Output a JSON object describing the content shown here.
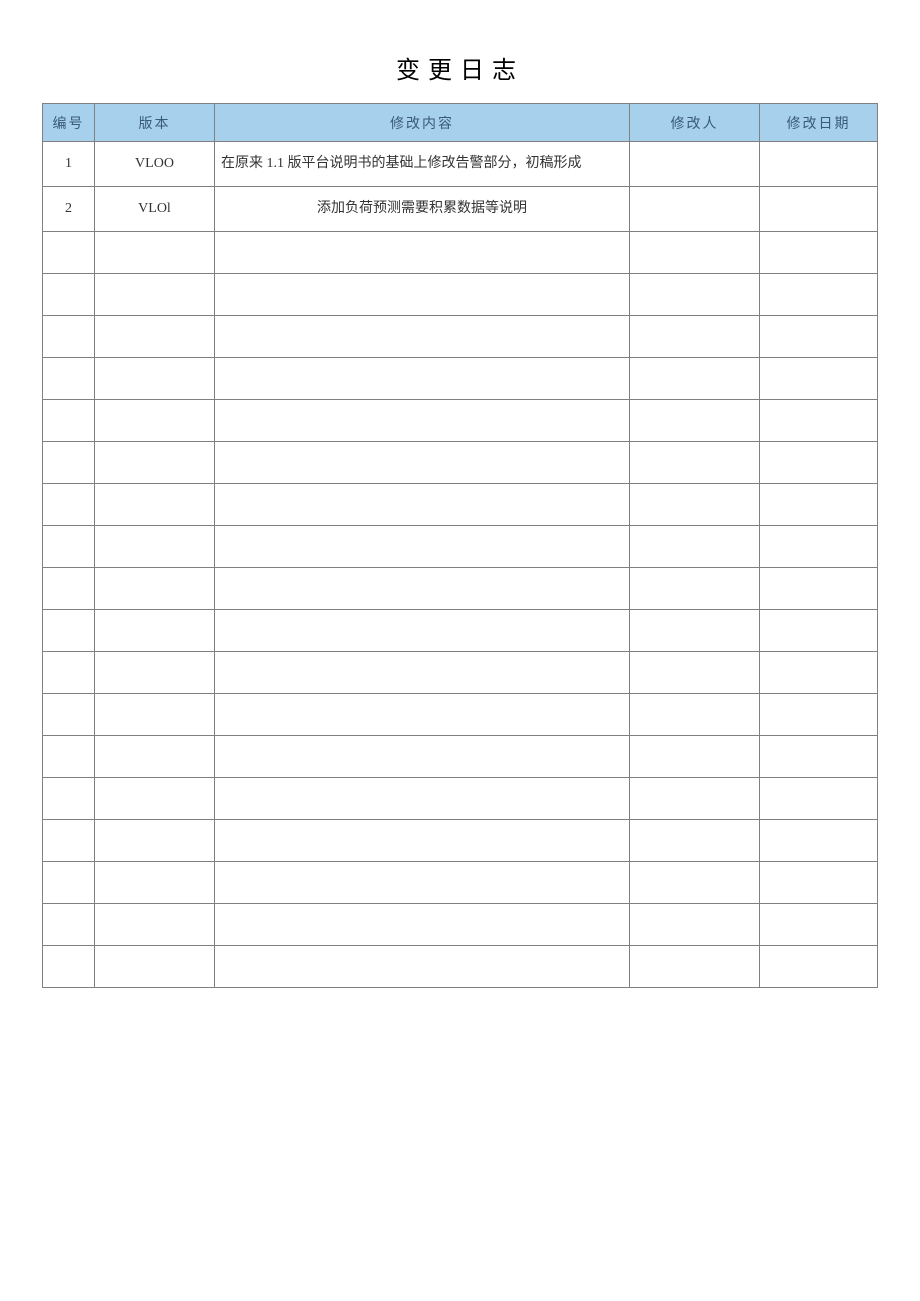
{
  "title": "变更日志",
  "columns": {
    "id": "编号",
    "version": "版本",
    "content": "修改内容",
    "author": "修改人",
    "date": "修改日期"
  },
  "rows": [
    {
      "id": "1",
      "version": "VLOO",
      "content": "在原来 1.1 版平台说明书的基础上修改告警部分，初稿形成",
      "author": "",
      "date": "",
      "content_align": "left",
      "tall": true
    },
    {
      "id": "2",
      "version": "VLOl",
      "content": "添加负荷预测需要积累数据等说明",
      "author": "",
      "date": "",
      "content_align": "center",
      "tall": false
    },
    {
      "id": "",
      "version": "",
      "content": "",
      "author": "",
      "date": "",
      "content_align": "left",
      "tall": false
    },
    {
      "id": "",
      "version": "",
      "content": "",
      "author": "",
      "date": "",
      "content_align": "left",
      "tall": false
    },
    {
      "id": "",
      "version": "",
      "content": "",
      "author": "",
      "date": "",
      "content_align": "left",
      "tall": false
    },
    {
      "id": "",
      "version": "",
      "content": "",
      "author": "",
      "date": "",
      "content_align": "left",
      "tall": false
    },
    {
      "id": "",
      "version": "",
      "content": "",
      "author": "",
      "date": "",
      "content_align": "left",
      "tall": false
    },
    {
      "id": "",
      "version": "",
      "content": "",
      "author": "",
      "date": "",
      "content_align": "left",
      "tall": false
    },
    {
      "id": "",
      "version": "",
      "content": "",
      "author": "",
      "date": "",
      "content_align": "left",
      "tall": false
    },
    {
      "id": "",
      "version": "",
      "content": "",
      "author": "",
      "date": "",
      "content_align": "left",
      "tall": false
    },
    {
      "id": "",
      "version": "",
      "content": "",
      "author": "",
      "date": "",
      "content_align": "left",
      "tall": false
    },
    {
      "id": "",
      "version": "",
      "content": "",
      "author": "",
      "date": "",
      "content_align": "left",
      "tall": false
    },
    {
      "id": "",
      "version": "",
      "content": "",
      "author": "",
      "date": "",
      "content_align": "left",
      "tall": false
    },
    {
      "id": "",
      "version": "",
      "content": "",
      "author": "",
      "date": "",
      "content_align": "left",
      "tall": false
    },
    {
      "id": "",
      "version": "",
      "content": "",
      "author": "",
      "date": "",
      "content_align": "left",
      "tall": false
    },
    {
      "id": "",
      "version": "",
      "content": "",
      "author": "",
      "date": "",
      "content_align": "left",
      "tall": false
    },
    {
      "id": "",
      "version": "",
      "content": "",
      "author": "",
      "date": "",
      "content_align": "left",
      "tall": false
    },
    {
      "id": "",
      "version": "",
      "content": "",
      "author": "",
      "date": "",
      "content_align": "left",
      "tall": false
    },
    {
      "id": "",
      "version": "",
      "content": "",
      "author": "",
      "date": "",
      "content_align": "left",
      "tall": false
    },
    {
      "id": "",
      "version": "",
      "content": "",
      "author": "",
      "date": "",
      "content_align": "left",
      "tall": false
    }
  ]
}
